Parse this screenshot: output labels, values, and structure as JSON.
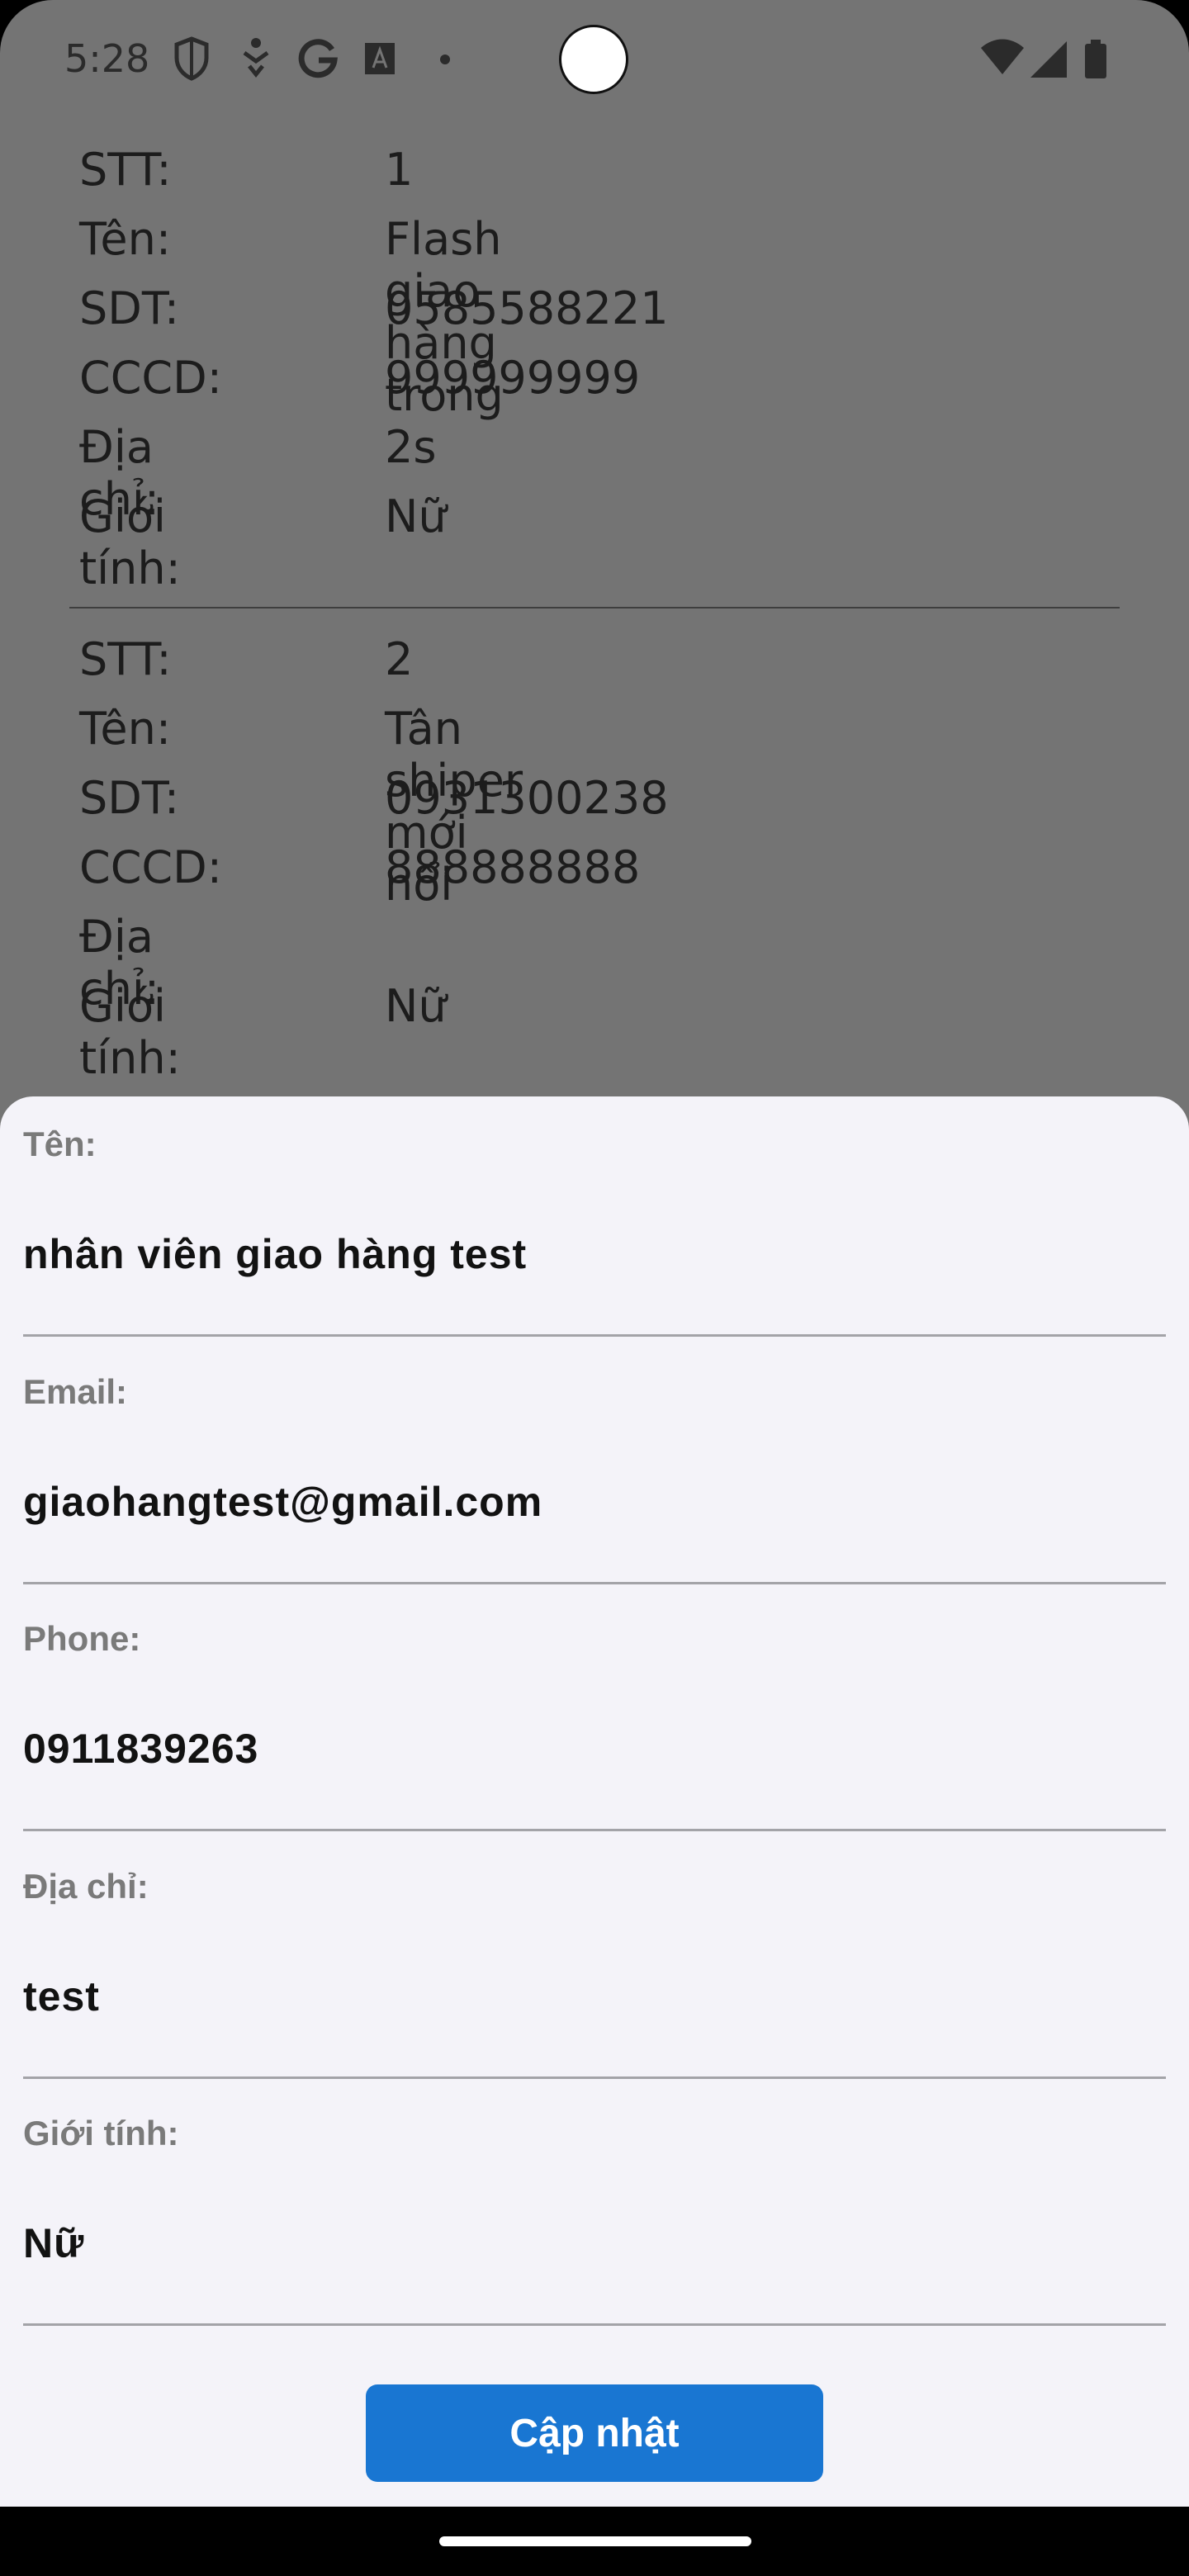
{
  "status_bar": {
    "time": "5:28",
    "left_icons": [
      "shield-icon",
      "accessibility-icon",
      "google-icon",
      "text-a-icon",
      "dot-icon"
    ],
    "right_icons": [
      "wifi-icon",
      "signal-icon",
      "battery-icon"
    ]
  },
  "records": [
    {
      "stt_label": "STT:",
      "stt": "1",
      "name_label": "Tên:",
      "name": "Flash giao hàng trong 2s",
      "phone_label": "SDT:",
      "phone": "0585588221",
      "id_label": "CCCD:",
      "id": "999999999",
      "address_label": "Địa chỉ:",
      "address": "",
      "gender_label": "Giới tính:",
      "gender": "Nữ"
    },
    {
      "stt_label": "STT:",
      "stt": "2",
      "name_label": "Tên:",
      "name": "Tân shiper mới nổi",
      "phone_label": "SDT:",
      "phone": "0931300238",
      "id_label": "CCCD:",
      "id": "888888888",
      "address_label": "Địa chỉ:",
      "address": "",
      "gender_label": "Giới tính:",
      "gender": "Nữ"
    }
  ],
  "form": {
    "fields": [
      {
        "label": "Tên:",
        "value": "nhân viên giao hàng test"
      },
      {
        "label": "Email:",
        "value": "giaohangtest@gmail.com"
      },
      {
        "label": "Phone:",
        "value": "0911839263"
      },
      {
        "label": "Địa chỉ:",
        "value": "test"
      },
      {
        "label": "Giới tính:",
        "value": "Nữ"
      }
    ],
    "submit_label": "Cập nhật"
  },
  "colors": {
    "accent": "#1976d2",
    "scrim": "#747474",
    "sheet_background": "#f4f3f9"
  }
}
